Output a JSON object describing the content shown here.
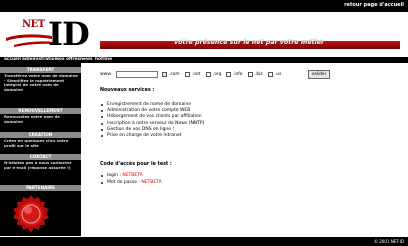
{
  "header": {
    "return_link": "retour page d'accueil",
    "logo_net": "NET",
    "logo_id": "ID",
    "slogan": "votre présence sur le net par votre métier"
  },
  "nav": {
    "items": [
      "accueil",
      "administration",
      "nos offres",
      "news",
      "hotline"
    ]
  },
  "sidebar": {
    "sections": [
      {
        "heading": "TRANSFERT",
        "text": "Transférez votre nom de domaine - Simplifiez le rapatriement intégral de votre nom de domaine"
      },
      {
        "heading": "RENOUVELLEMENT",
        "text": "Renouvelez votre nom de domaine"
      },
      {
        "heading": "CREATION",
        "text": "Créez en quelques clics votre profil sur le site"
      },
      {
        "heading": "CONTACT",
        "text": "N'hésitez pas à nous contacter par e-mail (réponse assurée !)"
      },
      {
        "heading": "PARTENAIRE",
        "text": ""
      }
    ]
  },
  "search": {
    "label": "www.",
    "value": "",
    "extensions": [
      {
        "label": ".com",
        "checked": true
      },
      {
        "label": ".net",
        "checked": false
      },
      {
        "label": ".org",
        "checked": false
      },
      {
        "label": ".info",
        "checked": false
      },
      {
        "label": ".biz",
        "checked": false
      },
      {
        "label": ".us",
        "checked": false
      }
    ],
    "button_label": "valider"
  },
  "services": {
    "title": "Nouveaux services :",
    "items": [
      "Enregistrement de nome de domaine",
      "Administration de votre compte WEB",
      "Hébergement de vos clients par affiliation",
      "Inscription à notre serveur de News (NNTP)",
      "Gestion de vos DNS en ligne !",
      "Prise en charge de votre Intranet"
    ]
  },
  "access": {
    "title": "Code d'accès pour le test :",
    "login_label": "login : ",
    "login_value": "NETBETA",
    "password_label": "Mot de passe : ",
    "password_value": "NETBETA"
  },
  "footer": {
    "text": "© 2001 NET-ID"
  },
  "colors": {
    "brand_red": "#b00000",
    "bar_black": "#000000"
  }
}
